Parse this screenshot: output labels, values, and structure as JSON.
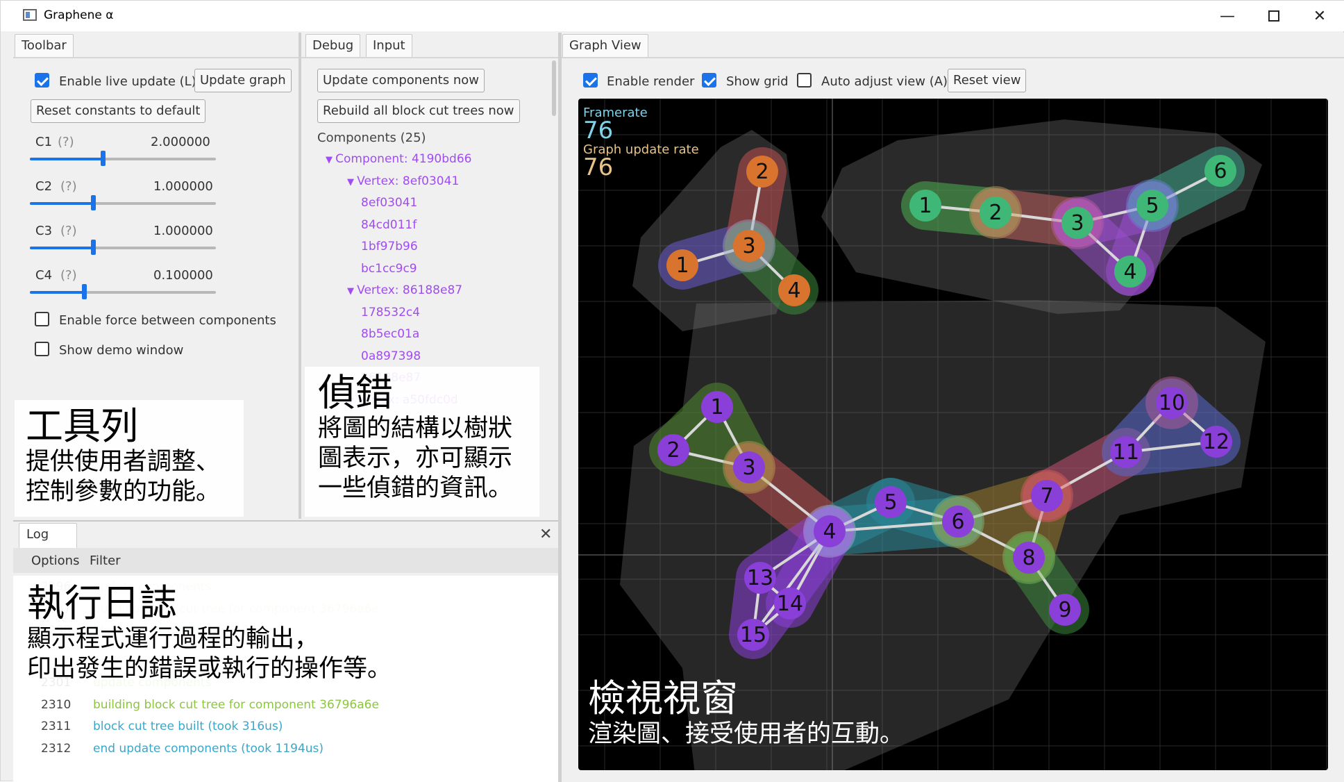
{
  "window": {
    "title": "Graphene α"
  },
  "toolbar": {
    "tab": "Toolbar",
    "live_update_label": "Enable live update (L)",
    "update_graph": "Update graph",
    "reset_constants": "Reset constants to default",
    "constants": [
      {
        "name": "C1",
        "help": "(?)",
        "value": "2.000000",
        "level": 0.39
      },
      {
        "name": "C2",
        "help": "(?)",
        "value": "1.000000",
        "level": 0.34
      },
      {
        "name": "C3",
        "help": "(?)",
        "value": "1.000000",
        "level": 0.34
      },
      {
        "name": "C4",
        "help": "(?)",
        "value": "0.100000",
        "level": 0.29
      }
    ],
    "force_label": "Enable force between components",
    "demo_label": "Show demo window",
    "live_update_checked": true,
    "force_checked": false,
    "demo_checked": false
  },
  "debug": {
    "tabs": [
      "Debug",
      "Input"
    ],
    "update_components": "Update components now",
    "rebuild": "Rebuild all block cut trees now",
    "components_header": "Components (25)",
    "tree": [
      {
        "text": "Component: 4190bd66",
        "level": 0,
        "arrow": true
      },
      {
        "text": "Vertex: 8ef03041",
        "level": 1,
        "arrow": true
      },
      {
        "text": "8ef03041",
        "level": 2
      },
      {
        "text": "84cd011f",
        "level": 2
      },
      {
        "text": "1bf97b96",
        "level": 2
      },
      {
        "text": "bc1cc9c9",
        "level": 2
      },
      {
        "text": "Vertex: 86188e87",
        "level": 1,
        "arrow": true
      },
      {
        "text": "178532c4",
        "level": 2
      },
      {
        "text": "8b5ec01a",
        "level": 2
      },
      {
        "text": "0a897398",
        "level": 2
      },
      {
        "text": "86188e87",
        "level": 2
      },
      {
        "text": "Vertex: a50fdc0d",
        "level": 1,
        "arrow": true
      }
    ]
  },
  "log": {
    "tab": "Log",
    "menu": [
      "Options",
      "Filter"
    ],
    "lines": [
      {
        "n": "2301",
        "text": "update components",
        "color": "#8cc63f"
      },
      {
        "n": "2310",
        "text": "building block cut tree for component 36796a6e",
        "color": "#8cc63f"
      },
      {
        "n": "2311",
        "text": "block cut tree built (took 316us)",
        "color": "#3aa7c9"
      },
      {
        "n": "2312",
        "text": "end update components (took 1194us)",
        "color": "#3aa7c9"
      }
    ],
    "faded": [
      {
        "n": "2296",
        "text": "update components",
        "color": "#8cc63f"
      },
      {
        "n": "2297",
        "text": "building block cut tree for component 36796a6e",
        "color": "#8cc63f"
      },
      {
        "n": "2298",
        "text": "block cut tree built (took 252us)",
        "color": "#3aa7c9"
      }
    ]
  },
  "graph_view": {
    "tab": "Graph View",
    "enable_render": "Enable render",
    "show_grid": "Show grid",
    "auto_adjust": "Auto adjust view (A)",
    "reset_view": "Reset view",
    "framerate_label": "Framerate",
    "framerate_value": "76",
    "update_rate_label": "Graph update rate",
    "update_rate_value": "76",
    "enable_render_checked": true,
    "show_grid_checked": true,
    "auto_adjust_checked": false
  },
  "overlays": {
    "toolbar": {
      "title": "工具列",
      "text": "提供使用者調整、\n控制參數的功能。"
    },
    "debug": {
      "title": "偵錯",
      "text": "將圖的結構以樹狀\n圖表示，亦可顯示\n一些偵錯的資訊。"
    },
    "log": {
      "title": "執行日誌",
      "text": "顯示程式運行過程的輸出，\n印出發生的錯誤或執行的操作等。"
    },
    "view": {
      "title": "檢視視窗",
      "text": "渲染圖、接受使用者的互動。"
    }
  },
  "graph": {
    "colors": {
      "orange": "#d9742f",
      "green": "#3fb877",
      "purple": "#8a3fd8",
      "edge": "#d8d8d8"
    },
    "node_labels": {
      "a": [
        "1",
        "2",
        "3",
        "4"
      ],
      "b": [
        "1",
        "2",
        "3",
        "4",
        "5",
        "6"
      ],
      "c": [
        "1",
        "2",
        "3",
        "4",
        "5",
        "6",
        "7",
        "8",
        "9",
        "10",
        "11",
        "12",
        "13",
        "14",
        "15"
      ]
    }
  }
}
